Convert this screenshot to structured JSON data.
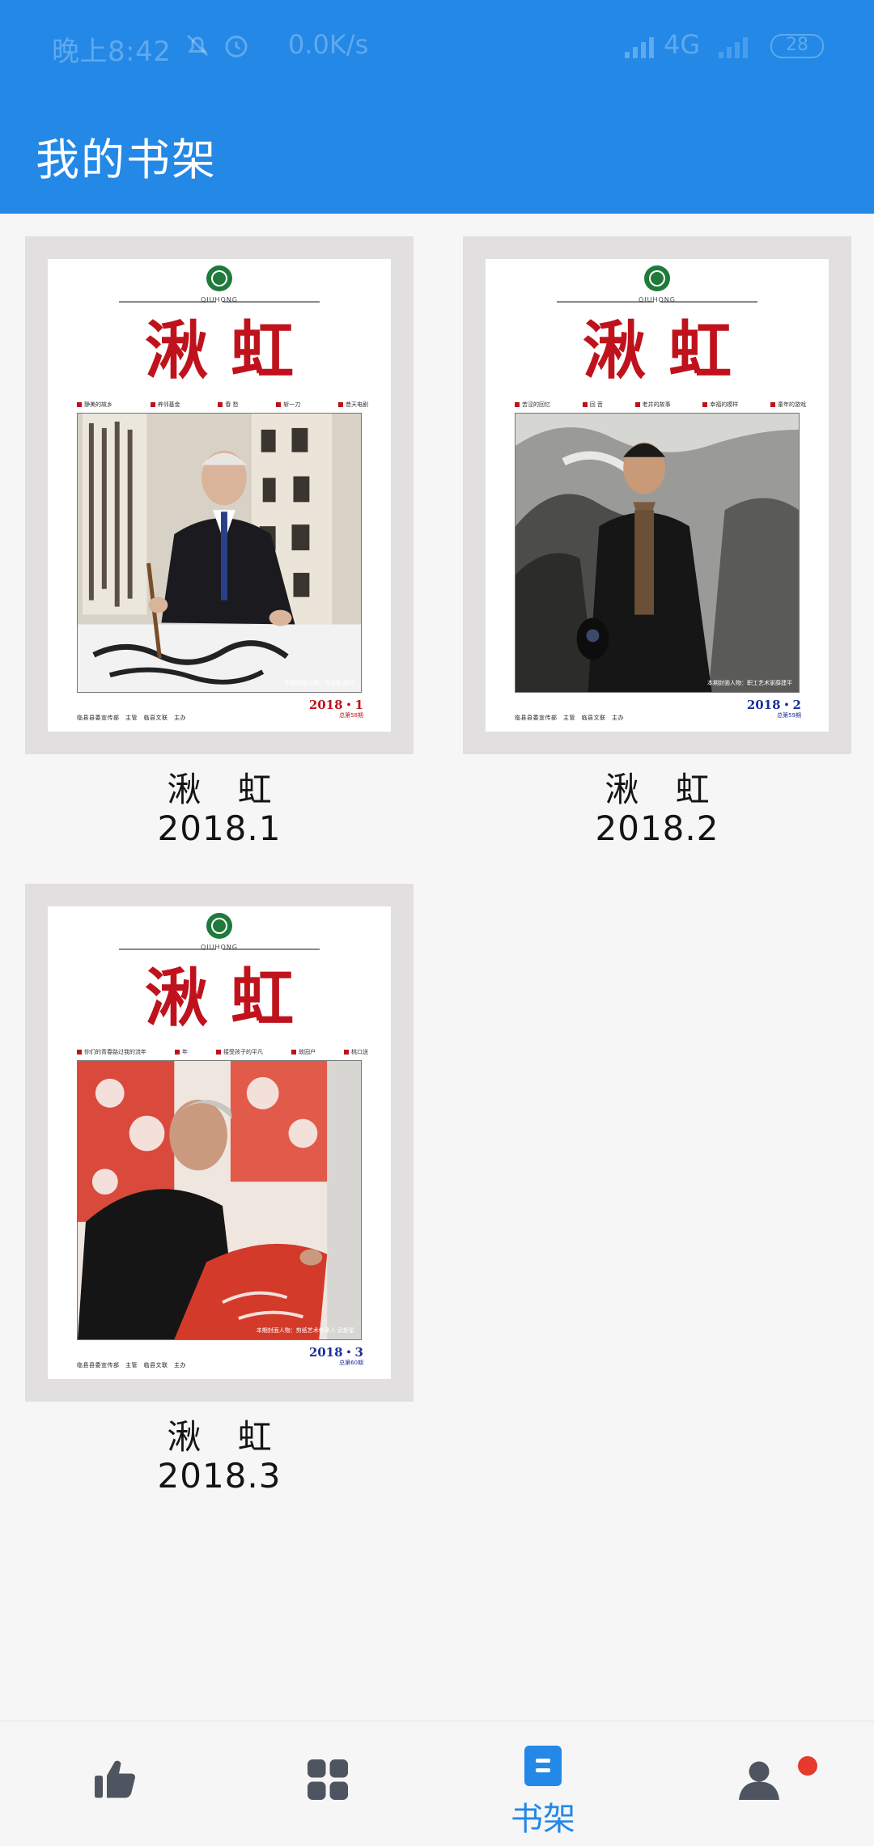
{
  "status_bar": {
    "time": "晚上8:42",
    "net_speed": "0.0K/s",
    "network": "4G",
    "battery": "28"
  },
  "header": {
    "title": "我的书架"
  },
  "colors": {
    "header_bg": "#2388e6",
    "accent": "#2388e6",
    "page_bg": "#f7f6f6",
    "masthead_red": "#c0121c",
    "badge_red": "#e53a2c",
    "icon_gray": "#4f5560"
  },
  "books": [
    {
      "title": "湫 虹",
      "issue": "2018.1",
      "cover": {
        "logo_text": "QIUHONG",
        "masthead": "湫虹",
        "topics": [
          "静美的故乡",
          "养邻基金",
          "春 愁",
          "斩一刀",
          "昔天电剧"
        ],
        "photo_caption": "本期封面人物：书法家 杨经",
        "issue_date": "2018・1",
        "issue_total": "总第58期",
        "date_color": "#c0121c",
        "publisher": "临县县委宣传部　主管　临县文联　主办"
      }
    },
    {
      "title": "湫 虹",
      "issue": "2018.2",
      "cover": {
        "logo_text": "QIUHONG",
        "masthead": "湫虹",
        "topics": [
          "苦涩的回忆",
          "回 音",
          "老井的故事",
          "幸福的模样",
          "童年的游戏"
        ],
        "photo_caption": "本期封面人物：职工艺术家薛建平",
        "issue_date": "2018・2",
        "issue_total": "总第59期",
        "date_color": "#1a2f9a",
        "publisher": "临县县委宣传部　主管　临县文联　主办"
      }
    },
    {
      "title": "湫 虹",
      "issue": "2018.3",
      "cover": {
        "logo_text": "QIUHONG",
        "masthead": "湫虹",
        "topics": [
          "你们的青春路过我的流年",
          "年",
          "接受孩子的平凡",
          "故园户",
          "桃口送"
        ],
        "photo_caption": "本期封面人物：剪纸艺术传承人 武新星",
        "issue_date": "2018・3",
        "issue_total": "总第60期",
        "date_color": "#1a2f9a",
        "publisher": "临县县委宣传部　主管　临县文联　主办"
      }
    }
  ],
  "bottom_nav": {
    "items": [
      {
        "icon": "thumbs-up-icon",
        "label": "",
        "active": false
      },
      {
        "icon": "grid-icon",
        "label": "",
        "active": false
      },
      {
        "icon": "bookshelf-icon",
        "label": "书架",
        "active": true
      },
      {
        "icon": "user-icon",
        "label": "",
        "active": false,
        "badge": true
      }
    ]
  }
}
